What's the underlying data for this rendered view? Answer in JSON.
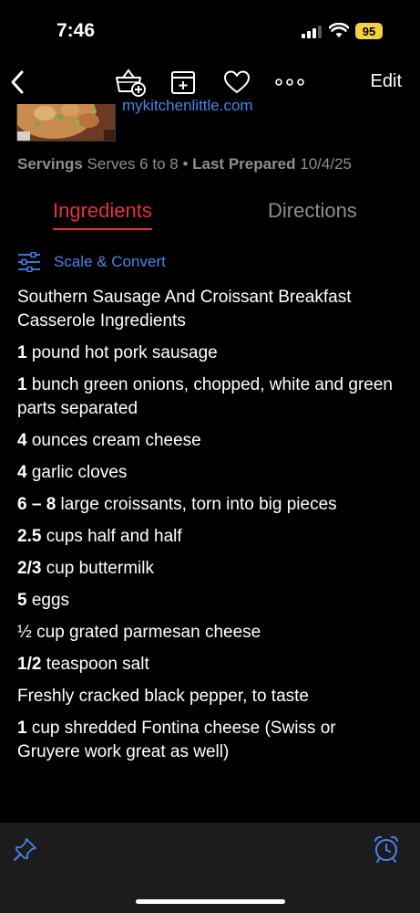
{
  "status": {
    "time": "7:46",
    "battery": "95"
  },
  "nav": {
    "back_icon": "chevron-left-icon",
    "icons": [
      "basket-plus-icon",
      "add-to-collection-icon",
      "heart-icon",
      "more-icon"
    ],
    "edit_label": "Edit"
  },
  "header": {
    "source": "mykitchenlittle.com"
  },
  "meta": {
    "servings_label": "Servings",
    "servings_value": "Serves 6 to 8",
    "separator": "•",
    "last_prepared_label": "Last Prepared",
    "last_prepared_value": "10/4/25"
  },
  "tabs": {
    "ingredients": "Ingredients",
    "directions": "Directions",
    "active": "ingredients"
  },
  "scale": {
    "label": "Scale & Convert",
    "icon": "sliders-icon"
  },
  "ingredients": [
    {
      "qty": "",
      "text": "Southern Sausage And Croissant Breakfast Casserole Ingredients"
    },
    {
      "qty": "1",
      "text": "pound hot pork sausage"
    },
    {
      "qty": "1",
      "text": "bunch green onions, chopped, white and green parts separated"
    },
    {
      "qty": "4",
      "text": "ounces cream cheese"
    },
    {
      "qty": "4",
      "text": "garlic cloves"
    },
    {
      "qty": "6 – 8",
      "text": "large croissants, torn into big pieces"
    },
    {
      "qty": "2.5",
      "text": "cups half and half"
    },
    {
      "qty": "2/3",
      "text": "cup buttermilk"
    },
    {
      "qty": "5",
      "text": "eggs"
    },
    {
      "qty": "",
      "text": "½ cup grated parmesan cheese"
    },
    {
      "qty": "1/2",
      "text": "teaspoon salt"
    },
    {
      "qty": "",
      "text": "Freshly cracked black pepper, to taste"
    },
    {
      "qty": "1",
      "text": "cup shredded Fontina cheese (Swiss or Gruyere work great as well)"
    }
  ],
  "toolbar": {
    "left_icon": "pin-icon",
    "right_icon": "alarm-clock-icon"
  },
  "colors": {
    "accent_red": "#e4343a",
    "link_blue": "#4a84e8",
    "muted": "#8e8e93"
  }
}
